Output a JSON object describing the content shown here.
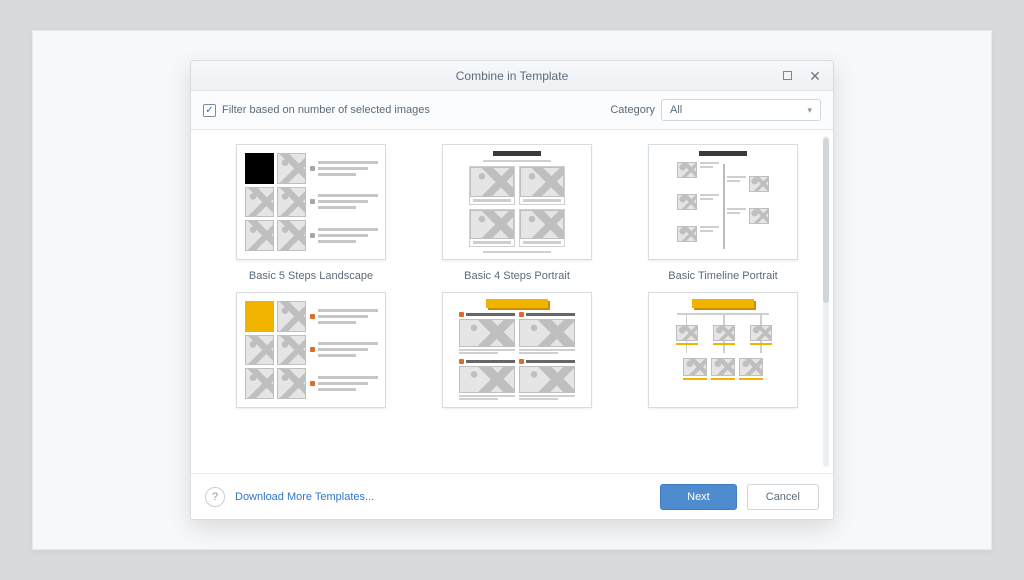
{
  "dialog": {
    "title": "Combine in Template"
  },
  "filter": {
    "checkbox_label": "Filter based on number of selected images",
    "checked": true,
    "category_label": "Category",
    "category_value": "All"
  },
  "templates": [
    {
      "name": "Basic 5 Steps Landscape"
    },
    {
      "name": "Basic 4 Steps Portrait"
    },
    {
      "name": "Basic Timeline Portrait"
    }
  ],
  "footer": {
    "download_link": "Download More Templates...",
    "next": "Next",
    "cancel": "Cancel",
    "help_symbol": "?"
  },
  "glyphs": {
    "check": "✓",
    "close": "✕",
    "triangleDown": "▾"
  }
}
